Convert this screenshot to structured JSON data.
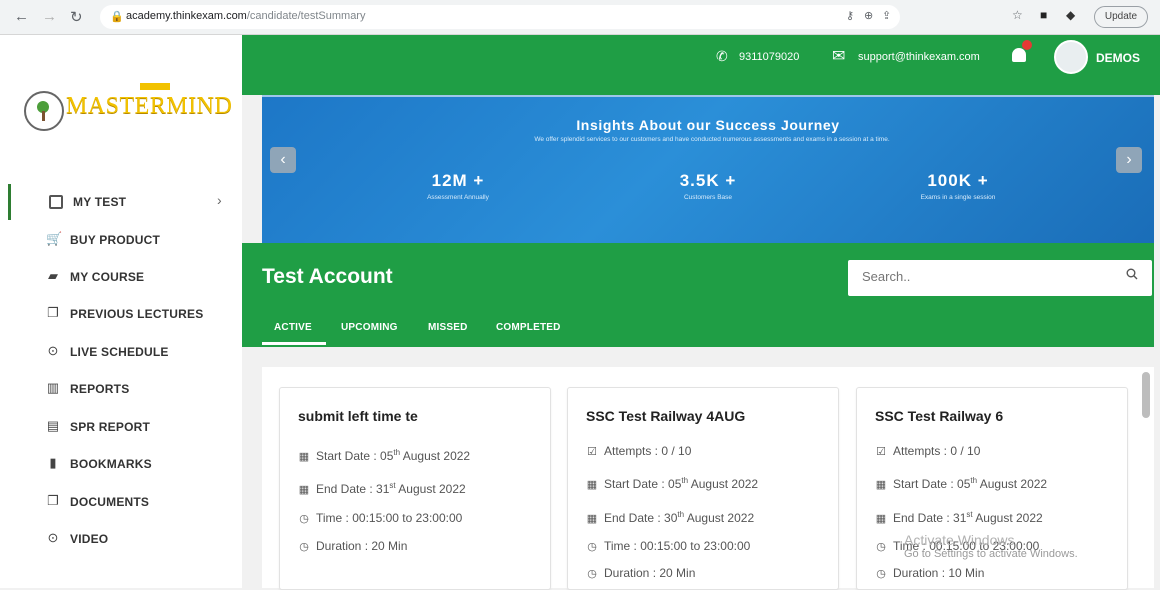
{
  "browser": {
    "url_host": "academy.thinkexam.com",
    "url_path": "/candidate/testSummary",
    "update_label": "Update"
  },
  "sidebar": {
    "brand": "MASTERMIND",
    "items": [
      {
        "label": "MY TEST",
        "icon": "checkbox-icon",
        "active": true
      },
      {
        "label": "BUY PRODUCT",
        "icon": "cart-icon"
      },
      {
        "label": "MY COURSE",
        "icon": "book-icon"
      },
      {
        "label": "PREVIOUS LECTURES",
        "icon": "copy-icon"
      },
      {
        "label": "LIVE SCHEDULE",
        "icon": "play-circle-icon"
      },
      {
        "label": "REPORTS",
        "icon": "bar-chart-icon"
      },
      {
        "label": "SPR REPORT",
        "icon": "file-icon"
      },
      {
        "label": "BOOKMARKS",
        "icon": "bookmark-icon"
      },
      {
        "label": "DOCUMENTS",
        "icon": "copy-icon"
      },
      {
        "label": "VIDEO",
        "icon": "play-circle-icon"
      }
    ]
  },
  "header": {
    "phone": "9311079020",
    "email": "support@thinkexam.com",
    "user": "DEMOS"
  },
  "banner": {
    "title": "Insights About our Success Journey",
    "subtitle": "We offer splendid services to our customers and have conducted numerous assessments and exams in a session at a time.",
    "stats": [
      {
        "value": "12M +",
        "caption": "Assessment Annually"
      },
      {
        "value": "3.5K +",
        "caption": "Customers Base"
      },
      {
        "value": "100K +",
        "caption": "Exams in a single session"
      }
    ]
  },
  "page": {
    "title": "Test Account",
    "search_placeholder": "Search..",
    "tabs": [
      "ACTIVE",
      "UPCOMING",
      "MISSED",
      "COMPLETED"
    ]
  },
  "cards": [
    {
      "title": "submit left time te",
      "start_label": "Start Date : 05",
      "start_sup": "th",
      "start_rest": " August 2022",
      "end_label": "End Date : 31",
      "end_sup": "st",
      "end_rest": " August 2022",
      "time": "Time : 00:15:00 to 23:00:00",
      "duration": "Duration : 20 Min"
    },
    {
      "title": "SSC Test Railway 4AUG",
      "attempts": "Attempts : 0 / 10",
      "start_label": "Start Date : 05",
      "start_sup": "th",
      "start_rest": " August 2022",
      "end_label": "End Date : 30",
      "end_sup": "th",
      "end_rest": " August 2022",
      "time": "Time : 00:15:00 to 23:00:00",
      "duration": "Duration : 20 Min"
    },
    {
      "title": "SSC Test Railway 6",
      "attempts": "Attempts : 0 / 10",
      "start_label": "Start Date : 05",
      "start_sup": "th",
      "start_rest": " August 2022",
      "end_label": "End Date : 31",
      "end_sup": "st",
      "end_rest": " August 2022",
      "time": "Time : 00:15:00 to 23:00:00",
      "duration": "Duration : 10 Min"
    }
  ],
  "watermark": {
    "line1": "Activate Windows",
    "line2": "Go to Settings to activate Windows."
  },
  "colors": {
    "brand_green": "#1f9e45",
    "banner_blue": "#1d77c7",
    "logo_gold": "#f2c200"
  }
}
